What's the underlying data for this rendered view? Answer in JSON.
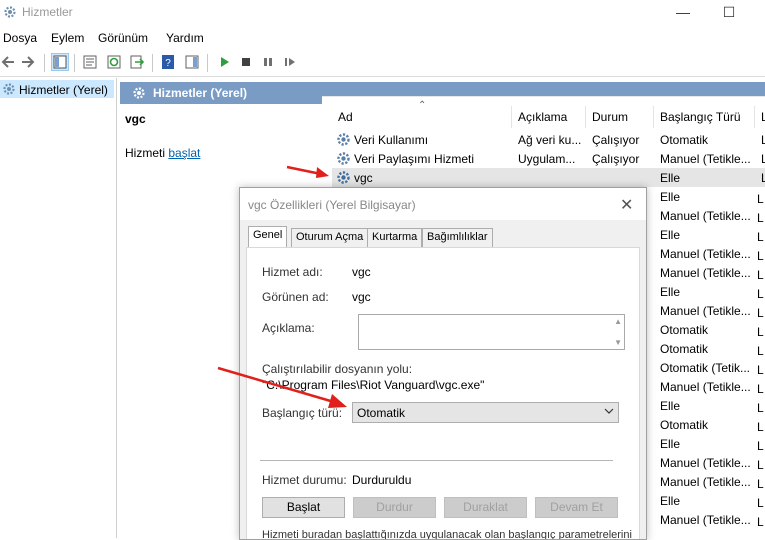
{
  "window": {
    "title": "Hizmetler"
  },
  "menu": [
    "Dosya",
    "Eylem",
    "Görünüm",
    "Yardım"
  ],
  "tree": {
    "item": "Hizmetler (Yerel)"
  },
  "main_header": "Hizmetler (Yerel)",
  "details": {
    "title": "vgc",
    "action_prefix": "Hizmeti ",
    "action_link": "başlat"
  },
  "columns": [
    "Ad",
    "Açıklama",
    "Durum",
    "Başlangıç Türü",
    "L"
  ],
  "rows": [
    {
      "name": "Veri Kullanımı",
      "desc": "Ağ veri ku...",
      "status": "Çalışıyor",
      "startup": "Otomatik"
    },
    {
      "name": "Veri Paylaşımı Hizmeti",
      "desc": "Uygulam...",
      "status": "Çalışıyor",
      "startup": "Manuel (Tetikle..."
    },
    {
      "name": "vgc",
      "desc": "",
      "status": "",
      "startup": "Elle"
    }
  ],
  "more_startup": [
    "Elle",
    "Manuel (Tetikle...",
    "Elle",
    "Manuel (Tetikle...",
    "Manuel (Tetikle...",
    "Elle",
    "Manuel (Tetikle...",
    "Otomatik",
    "Otomatik",
    "Otomatik (Tetik...",
    "Manuel (Tetikle...",
    "Elle",
    "Otomatik",
    "Elle",
    "Manuel (Tetikle...",
    "Manuel (Tetikle...",
    "Elle",
    "Manuel (Tetikle..."
  ],
  "dialog": {
    "title": "vgc Özellikleri (Yerel Bilgisayar)",
    "tabs": [
      "Genel",
      "Oturum Açma",
      "Kurtarma",
      "Bağımlılıklar"
    ],
    "service_name_label": "Hizmet adı:",
    "service_name": "vgc",
    "display_name_label": "Görünen ad:",
    "display_name": "vgc",
    "description_label": "Açıklama:",
    "exe_label": "Çalıştırılabilir dosyanın yolu:",
    "exe_path": "\"C:\\Program Files\\Riot Vanguard\\vgc.exe\"",
    "startup_label": "Başlangıç türü:",
    "startup_value": "Otomatik",
    "status_label": "Hizmet durumu:",
    "status_value": "Durduruldu",
    "buttons": {
      "start": "Başlat",
      "stop": "Durdur",
      "pause": "Duraklat",
      "resume": "Devam Et"
    },
    "bottom_text": "Hizmeti buradan başlattığınızda uygulanacak olan başlangıç parametrelerini"
  },
  "colors": {
    "header": "#7a9cc4",
    "selected": "#cce8ff",
    "link": "#0063b1",
    "arrow": "#e0201b"
  }
}
